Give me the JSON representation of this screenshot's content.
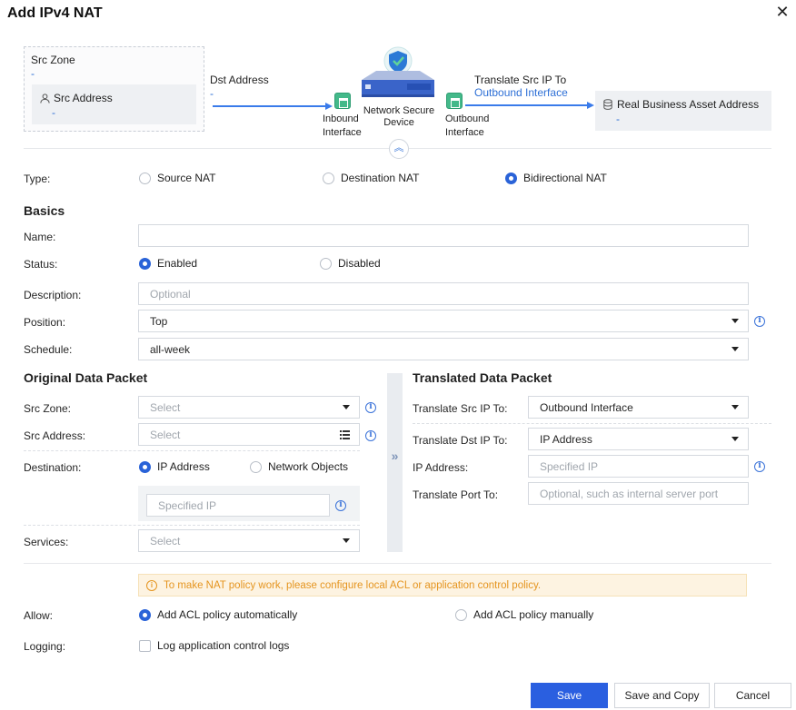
{
  "dialog": {
    "title": "Add IPv4 NAT",
    "close_glyph": "✕"
  },
  "diagram": {
    "src_zone_label": "Src Zone",
    "src_zone_value": "-",
    "src_address_label": "Src Address",
    "src_address_value": "-",
    "dst_address_label": "Dst Address",
    "dst_address_value": "-",
    "inbound_label": "Inbound Interface",
    "device_label": "Network Secure Device",
    "outbound_label": "Outbound Interface",
    "translate_label": "Translate Src IP To",
    "translate_value": "Outbound Interface",
    "real_asset_label": "Real Business Asset Address",
    "real_asset_value": "-"
  },
  "type": {
    "label": "Type:",
    "options": [
      "Source NAT",
      "Destination NAT",
      "Bidirectional NAT"
    ],
    "selected": "Bidirectional NAT"
  },
  "basics": {
    "heading": "Basics",
    "name_label": "Name:",
    "name_value": "",
    "status_label": "Status:",
    "status_options": [
      "Enabled",
      "Disabled"
    ],
    "status_selected": "Enabled",
    "description_label": "Description:",
    "description_placeholder": "Optional",
    "position_label": "Position:",
    "position_value": "Top",
    "schedule_label": "Schedule:",
    "schedule_value": "all-week"
  },
  "original": {
    "heading": "Original Data Packet",
    "src_zone_label": "Src Zone:",
    "src_zone_placeholder": "Select",
    "src_address_label": "Src Address:",
    "src_address_placeholder": "Select",
    "destination_label": "Destination:",
    "destination_options": [
      "IP Address",
      "Network Objects"
    ],
    "destination_selected": "IP Address",
    "destination_ip_placeholder": "Specified IP",
    "services_label": "Services:",
    "services_placeholder": "Select"
  },
  "translated": {
    "heading": "Translated Data Packet",
    "src_ip_label": "Translate Src IP To:",
    "src_ip_value": "Outbound Interface",
    "dst_ip_label": "Translate Dst IP To:",
    "dst_ip_value": "IP Address",
    "ip_address_label": "IP Address:",
    "ip_address_placeholder": "Specified IP",
    "port_label": "Translate Port To:",
    "port_placeholder": "Optional, such as internal server port"
  },
  "warning": {
    "text": "To make NAT policy work, please configure local ACL or application control policy."
  },
  "allow": {
    "label": "Allow:",
    "options": [
      "Add ACL policy automatically",
      "Add ACL policy manually"
    ],
    "selected": "Add ACL policy automatically"
  },
  "logging": {
    "label": "Logging:",
    "checkbox_label": "Log application control logs",
    "checked": false
  },
  "footer": {
    "save": "Save",
    "save_copy": "Save and Copy",
    "cancel": "Cancel"
  },
  "colors": {
    "primary": "#2a5fe0",
    "link": "#2d6fd6",
    "warning": "#e59520",
    "interface_icon": "#44b98a"
  }
}
